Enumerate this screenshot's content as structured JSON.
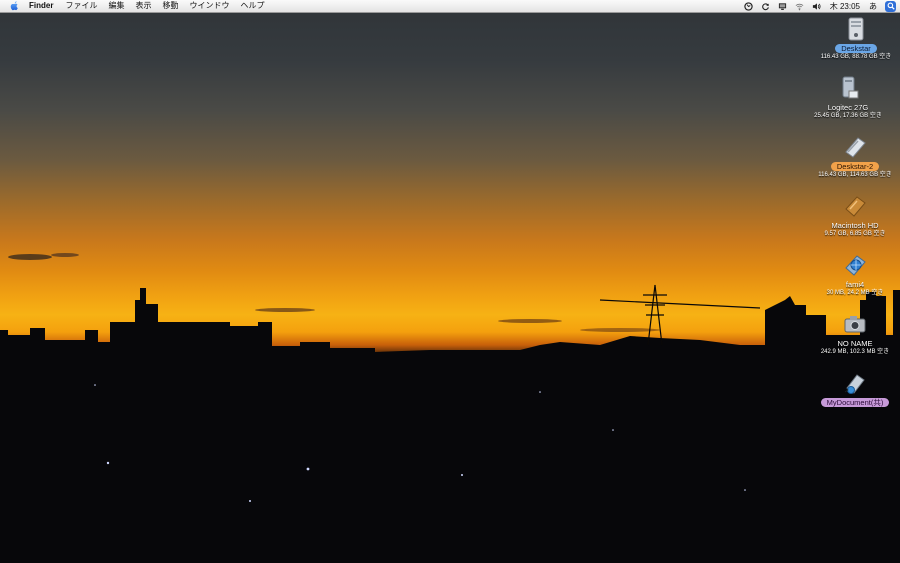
{
  "menubar": {
    "app_name": "Finder",
    "menus": [
      "ファイル",
      "編集",
      "表示",
      "移動",
      "ウインドウ",
      "ヘルプ"
    ],
    "clock": "木 23:05",
    "input_method": "あ",
    "status_icons": [
      "sync-icon",
      "refresh-icon",
      "display-icon",
      "wifi-icon",
      "volume-icon"
    ]
  },
  "desktop": {
    "icons": [
      {
        "name": "Deskstar",
        "info": "116.43 GB, 88.78 GB 空き",
        "kind": "drive",
        "label_color": "blue"
      },
      {
        "name": "Logitec 27G",
        "info": "25.45 GB, 17.36 GB 空き",
        "kind": "drive",
        "label_color": ""
      },
      {
        "name": "Deskstar-2",
        "info": "116.43 GB, 114.63 GB 空き",
        "kind": "drive",
        "label_color": "orange"
      },
      {
        "name": "Macintosh HD",
        "info": "9.57 GB, 6.85 GB 空き",
        "kind": "drive",
        "label_color": ""
      },
      {
        "name": "fami4",
        "info": "30 MB, 24.2 MB 空き",
        "kind": "network",
        "label_color": ""
      },
      {
        "name": "NO NAME",
        "info": "242.9 MB, 102.3 MB 空き",
        "kind": "camera",
        "label_color": ""
      },
      {
        "name": "MyDocument(共)",
        "info": "",
        "kind": "alias",
        "label_color": "purple"
      }
    ]
  },
  "colors": {
    "label_blue": "#6aa6e6",
    "label_orange": "#f2a24a",
    "label_purple": "#c79ad9",
    "spotlight": "#2f6fd8"
  }
}
